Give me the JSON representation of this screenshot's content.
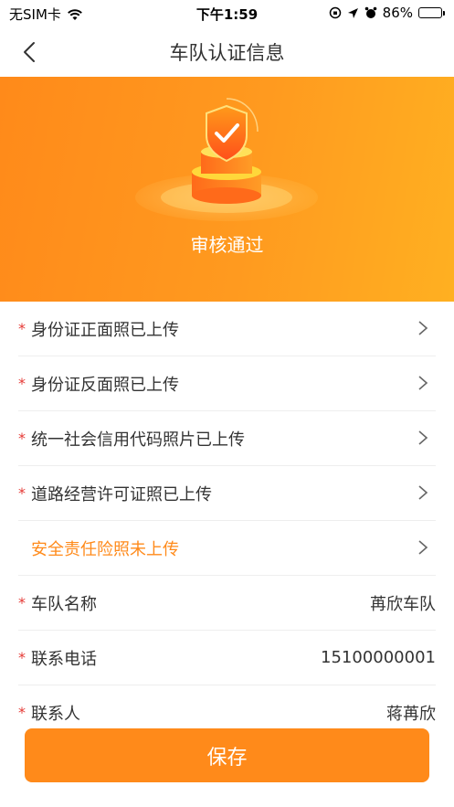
{
  "status_bar": {
    "carrier": "无SIM卡",
    "time": "下午1:59",
    "battery": "86%"
  },
  "nav": {
    "title": "车队认证信息"
  },
  "banner": {
    "status_text": "审核通过"
  },
  "rows": [
    {
      "label": "身份证正面照已上传",
      "required": true,
      "type": "link"
    },
    {
      "label": "身份证反面照已上传",
      "required": true,
      "type": "link"
    },
    {
      "label": "统一社会信用代码照片已上传",
      "required": true,
      "type": "link"
    },
    {
      "label": "道路经营许可证照已上传",
      "required": true,
      "type": "link"
    },
    {
      "label": "安全责任险照未上传",
      "required": false,
      "type": "link"
    },
    {
      "label": "车队名称",
      "required": true,
      "type": "value",
      "value": "苒欣车队"
    },
    {
      "label": "联系电话",
      "required": true,
      "type": "value",
      "value": "15100000001"
    },
    {
      "label": "联系人",
      "required": true,
      "type": "value",
      "value": "蒋苒欣"
    }
  ],
  "required_mark": "*",
  "save_button": {
    "label": "保存"
  },
  "colors": {
    "accent": "#ff8a1a",
    "required": "#e53935",
    "warning_text": "#ff8a1a"
  }
}
